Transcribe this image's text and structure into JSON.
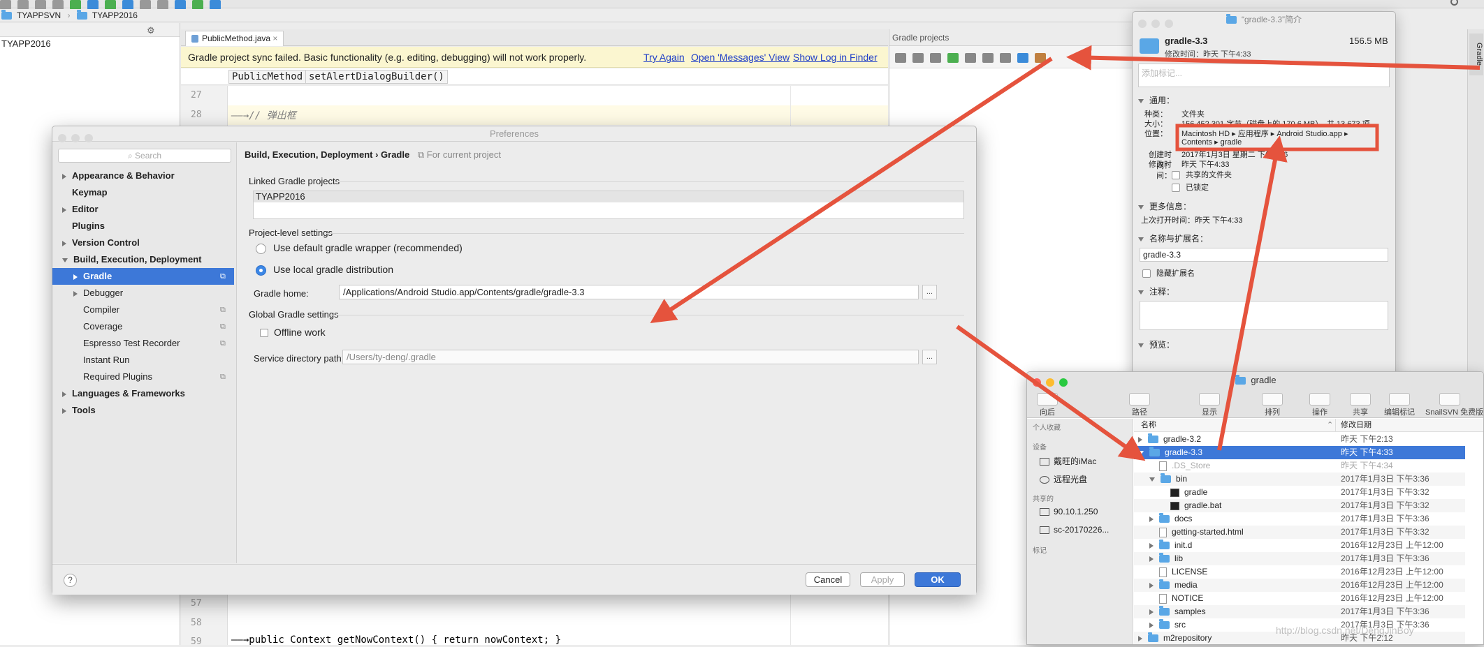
{
  "ide": {
    "breadcrumb_project": "TYAPPSVN",
    "breadcrumb_module": "TYAPP2016",
    "project_root": "TYAPP2016",
    "editor_tab": "PublicMethod.java",
    "editor_tab_close": "×",
    "notice_text": "Gradle project sync failed. Basic functionality (e.g. editing, debugging) will not work properly.",
    "notice_try_again": "Try Again",
    "notice_messages": "Open 'Messages' View",
    "notice_show_log": "Show Log in Finder",
    "crumb_class": "PublicMethod",
    "crumb_method": "setAlertDialogBuilder()",
    "gradle_panel_title": "Gradle projects",
    "gradle_side_tab": "Gradle",
    "lines": [
      {
        "num": "27",
        "code": ""
      },
      {
        "num": "28",
        "code": "——→// 弹出框"
      },
      {
        "num": "57",
        "code": ""
      },
      {
        "num": "58",
        "code": ""
      },
      {
        "num": "59",
        "code": "——→public Context getNowContext() { return nowContext; }"
      }
    ]
  },
  "prefs": {
    "title": "Preferences",
    "search_placeholder": "Search",
    "breadcrumb": "Build, Execution, Deployment › Gradle",
    "scope": "For current project",
    "nav": [
      {
        "label": "Appearance & Behavior",
        "bold": true,
        "arrow": "right"
      },
      {
        "label": "Keymap",
        "bold": true,
        "arrow": ""
      },
      {
        "label": "Editor",
        "bold": true,
        "arrow": "right"
      },
      {
        "label": "Plugins",
        "bold": true,
        "arrow": ""
      },
      {
        "label": "Version Control",
        "bold": true,
        "arrow": "right"
      },
      {
        "label": "Build, Execution, Deployment",
        "bold": true,
        "arrow": "down"
      },
      {
        "label": "Gradle",
        "bold": true,
        "arrow": "right",
        "selected": true,
        "indent": 1
      },
      {
        "label": "Debugger",
        "bold": false,
        "arrow": "right",
        "indent": 1
      },
      {
        "label": "Compiler",
        "bold": false,
        "arrow": "",
        "indent": 1
      },
      {
        "label": "Coverage",
        "bold": false,
        "arrow": "",
        "indent": 1
      },
      {
        "label": "Espresso Test Recorder",
        "bold": false,
        "arrow": "",
        "indent": 1
      },
      {
        "label": "Instant Run",
        "bold": false,
        "arrow": "",
        "indent": 1
      },
      {
        "label": "Required Plugins",
        "bold": false,
        "arrow": "",
        "indent": 1
      },
      {
        "label": "Languages & Frameworks",
        "bold": true,
        "arrow": "right"
      },
      {
        "label": "Tools",
        "bold": true,
        "arrow": "right"
      }
    ],
    "linked_label": "Linked Gradle projects",
    "linked_project": "TYAPP2016",
    "project_level": "Project-level settings",
    "radio_wrapper": "Use default gradle wrapper (recommended)",
    "radio_local": "Use local gradle distribution",
    "gradle_home_label": "Gradle home:",
    "gradle_home_value": "/Applications/Android Studio.app/Contents/gradle/gradle-3.3",
    "global_label": "Global Gradle settings",
    "offline_label": "Offline work",
    "service_label": "Service directory path:",
    "service_value": "/Users/ty-deng/.gradle",
    "browse": "...",
    "help": "?",
    "cancel": "Cancel",
    "apply": "Apply",
    "ok": "OK"
  },
  "info": {
    "title": "“gradle-3.3”简介",
    "name": "gradle-3.3",
    "size": "156.5 MB",
    "modified": "修改时间：昨天 下午4:33",
    "tags_placeholder": "添加标记...",
    "general": "通用：",
    "kind_label": "种类：",
    "kind": "文件夹",
    "size_label": "大小：",
    "size_full": "156,452,301 字节（磁盘上的 170.6 MB），共 13,673 项",
    "where_label": "位置：",
    "where_line1": "Macintosh HD ▸ 应用程序 ▸ Android Studio.app ▸",
    "where_line2": "Contents ▸ gradle",
    "created_label": "创建时间：",
    "created": "2017年1月3日 星期二 下午3:36",
    "modified_label": "修改时间：",
    "modified_value": "昨天 下午4:33",
    "shared": "共享的文件夹",
    "locked": "已锁定",
    "more_info": "更多信息：",
    "last_opened": "上次打开时间：昨天 下午4:33",
    "name_ext": "名称与扩展名：",
    "name_value": "gradle-3.3",
    "hide_ext": "隐藏扩展名",
    "comments": "注释：",
    "preview": "预览："
  },
  "finder": {
    "title": "gradle",
    "toolbar": [
      {
        "label": "向后"
      },
      {
        "label": "路径"
      },
      {
        "label": "显示"
      },
      {
        "label": "排列"
      },
      {
        "label": "操作"
      },
      {
        "label": "共享"
      },
      {
        "label": "编辑标记"
      },
      {
        "label": "SnailSVN 免费版"
      }
    ],
    "sidebar": [
      {
        "label": "个人收藏",
        "header": true
      },
      {
        "label": "设备",
        "header": true
      },
      {
        "label": "戴旺的iMac",
        "icon": "monitor-icon"
      },
      {
        "label": "远程光盘",
        "icon": "disc-icon"
      },
      {
        "label": "共享的",
        "header": true
      },
      {
        "label": "90.10.1.250",
        "icon": "monitor-icon"
      },
      {
        "label": "sc-20170226...",
        "icon": "monitor-icon"
      },
      {
        "label": "标记",
        "header": true
      }
    ],
    "col_name": "名称",
    "col_date": "修改日期",
    "rows": [
      {
        "name": "gradle-3.2",
        "date": "昨天 下午2:13",
        "indent": 0,
        "arrow": "right",
        "type": "folder"
      },
      {
        "name": "gradle-3.3",
        "date": "昨天 下午4:33",
        "indent": 0,
        "arrow": "down",
        "type": "folder",
        "selected": true
      },
      {
        "name": ".DS_Store",
        "date": "昨天 下午4:34",
        "indent": 1,
        "arrow": "",
        "type": "file",
        "dim": true
      },
      {
        "name": "bin",
        "date": "2017年1月3日 下午3:36",
        "indent": 1,
        "arrow": "down",
        "type": "folder"
      },
      {
        "name": "gradle",
        "date": "2017年1月3日 下午3:32",
        "indent": 2,
        "arrow": "",
        "type": "term"
      },
      {
        "name": "gradle.bat",
        "date": "2017年1月3日 下午3:32",
        "indent": 2,
        "arrow": "",
        "type": "term"
      },
      {
        "name": "docs",
        "date": "2017年1月3日 下午3:36",
        "indent": 1,
        "arrow": "right",
        "type": "folder"
      },
      {
        "name": "getting-started.html",
        "date": "2017年1月3日 下午3:32",
        "indent": 1,
        "arrow": "",
        "type": "file"
      },
      {
        "name": "init.d",
        "date": "2016年12月23日 上午12:00",
        "indent": 1,
        "arrow": "right",
        "type": "folder"
      },
      {
        "name": "lib",
        "date": "2017年1月3日 下午3:36",
        "indent": 1,
        "arrow": "right",
        "type": "folder"
      },
      {
        "name": "LICENSE",
        "date": "2016年12月23日 上午12:00",
        "indent": 1,
        "arrow": "",
        "type": "file"
      },
      {
        "name": "media",
        "date": "2016年12月23日 上午12:00",
        "indent": 1,
        "arrow": "right",
        "type": "folder"
      },
      {
        "name": "NOTICE",
        "date": "2016年12月23日 上午12:00",
        "indent": 1,
        "arrow": "",
        "type": "file"
      },
      {
        "name": "samples",
        "date": "2017年1月3日 下午3:36",
        "indent": 1,
        "arrow": "right",
        "type": "folder"
      },
      {
        "name": "src",
        "date": "2017年1月3日 下午3:36",
        "indent": 1,
        "arrow": "right",
        "type": "folder"
      },
      {
        "name": "m2repository",
        "date": "昨天 下午2:12",
        "indent": 0,
        "arrow": "right",
        "type": "folder"
      }
    ],
    "watermark": "http://blog.csdn.net/DengJinBoy"
  },
  "colors": {
    "accent": "#3d78d8",
    "arrow": "#e5533d",
    "notice": "#fbf6d0"
  }
}
